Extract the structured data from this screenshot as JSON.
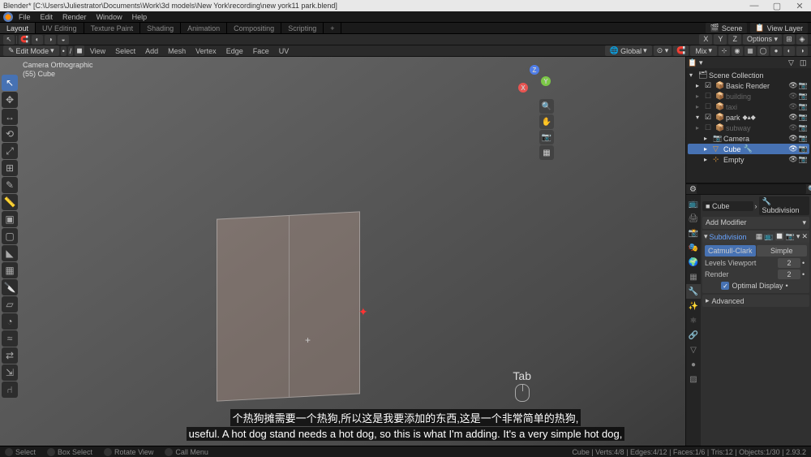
{
  "title": "Blender* [C:\\Users\\Juliestrator\\Documents\\Work\\3d models\\New York\\recording\\new york11 park.blend]",
  "menus": [
    "File",
    "Edit",
    "Render",
    "Window",
    "Help"
  ],
  "workspaces": [
    "Layout",
    "UV Editing",
    "Texture Paint",
    "Shading",
    "Animation",
    "Compositing",
    "Scripting"
  ],
  "active_workspace": "Layout",
  "scene_name": "Scene",
  "view_layer": "View Layer",
  "header_right": {
    "xyz": [
      "X",
      "Y",
      "Z"
    ],
    "options": "Options"
  },
  "viewport": {
    "global": "Global",
    "mix": "Mix",
    "mode": "Edit Mode",
    "menu_items": [
      "View",
      "Select",
      "Add",
      "Mesh",
      "Vertex",
      "Edge",
      "Face",
      "UV"
    ],
    "info_line1": "Camera Orthographic",
    "info_line2": "(55) Cube"
  },
  "tab_hint": "Tab",
  "outliner": {
    "root": "Scene Collection",
    "items": [
      {
        "name": "Basic Render",
        "ico": "📦",
        "dimmed": false
      },
      {
        "name": "building",
        "ico": "📦",
        "dimmed": true
      },
      {
        "name": "taxi",
        "ico": "📦",
        "dimmed": true
      },
      {
        "name": "park",
        "ico": "📦",
        "dimmed": false,
        "has_children": true,
        "color": "#c29c4b"
      },
      {
        "name": "subway",
        "ico": "📦",
        "dimmed": true
      }
    ],
    "children": [
      {
        "name": "Camera",
        "ico": "📷",
        "orange": true
      },
      {
        "name": "Cube",
        "ico": "▽",
        "orange": true,
        "selected": true
      },
      {
        "name": "Empty",
        "ico": "⊹",
        "orange": true
      }
    ]
  },
  "props": {
    "obj_name": "Cube",
    "mod_name": "Subdivision",
    "add_modifier": "Add Modifier",
    "panel_title": "Subdivision",
    "algo": {
      "a": "Catmull-Clark",
      "b": "Simple"
    },
    "levels_viewport_label": "Levels Viewport",
    "levels_viewport": 2,
    "render_label": "Render",
    "render": 2,
    "optimal": "Optimal Display",
    "advanced": "Advanced"
  },
  "subtitle_cn": "个热狗摊需要一个热狗,所以这是我要添加的东西,这是一个非常简单的热狗,",
  "subtitle_en": "useful. A hot dog stand needs a hot dog, so this is what I'm adding. It's a very simple hot dog,",
  "status": {
    "select": "Select",
    "box": "Box Select",
    "rotate": "Rotate View",
    "menu": "Call Menu",
    "stats": "Cube  |  Verts:4/8  |  Edges:4/12  |  Faces:1/6  |  Tris:12  |  Objects:1/30  |  2.93.2"
  }
}
